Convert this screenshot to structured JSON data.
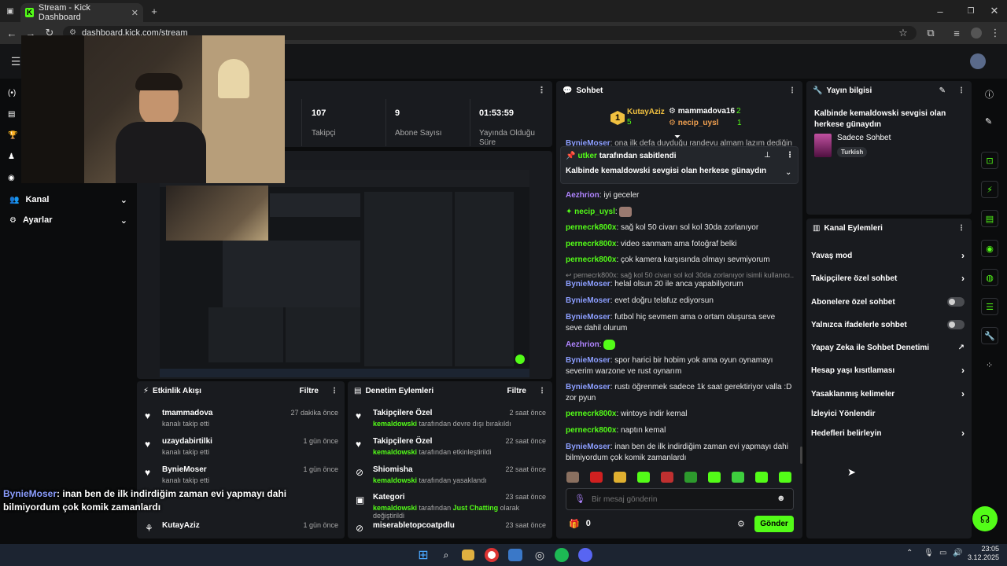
{
  "browser": {
    "tab_title": "Stream - Kick Dashboard",
    "url": "dashboard.kick.com/stream"
  },
  "sidebar": {
    "kanal": "Kanal",
    "ayarlar": "Ayarlar"
  },
  "stats": {
    "followers_value": "107",
    "followers_label": "Takipçi",
    "subs_value": "9",
    "subs_label": "Abone Sayısı",
    "uptime_value": "01:53:59",
    "uptime_label": "Yayında Olduğu Süre"
  },
  "activity": {
    "title": "Etkinlik Akışı",
    "filter": "Filtre",
    "items": [
      {
        "name": "tmammadova",
        "sub": "kanalı takip etti",
        "time": "27 dakika önce"
      },
      {
        "name": "uzaydabirtilki",
        "sub": "kanalı takip etti",
        "time": "1 gün önce"
      },
      {
        "name": "BynieMoser",
        "sub": "kanalı takip etti",
        "time": "1 gün önce"
      },
      {
        "name": "KutayAziz",
        "sub": "",
        "time": "1 gün önce"
      }
    ]
  },
  "moderation": {
    "title": "Denetim Eylemleri",
    "filter": "Filtre",
    "items": [
      {
        "name": "Takipçilere Özel",
        "user": "kemaldowski",
        "rest": "tarafından devre dışı bırakıldı",
        "time": "2 saat önce"
      },
      {
        "name": "Takipçilere Özel",
        "user": "kemaldowski",
        "rest": "tarafından etkinleştirildi",
        "time": "22 saat önce"
      },
      {
        "name": "Shiomisha",
        "user": "kemaldowski",
        "rest": "tarafından yasaklandı",
        "time": "22 saat önce"
      },
      {
        "name": "Kategori",
        "user": "kemaldowski",
        "rest": "tarafından",
        "category": "Just Chatting",
        "rest2": "olarak değiştirildi",
        "time": "23 saat önce"
      },
      {
        "name": "miserabletopcoatpdlu",
        "user": "",
        "rest": "",
        "time": "23 saat önce"
      }
    ]
  },
  "overlay_chat": {
    "user": "BynieMoser",
    "text": ": inan ben de ilk indirdiğim zaman evi yapmayı dahi bilmiyordum çok komik zamanlardı"
  },
  "chat": {
    "title": "Sohbet",
    "top_gifters": [
      {
        "rank": "1",
        "name": "KutayAziz",
        "count": "5"
      },
      {
        "name": "mammadova16",
        "count": "2"
      },
      {
        "name": "necip_uysl",
        "count": "1"
      }
    ],
    "cut_line_user": "BynieMoser",
    "cut_line_text": ": ona ilk defa duyduğu randevu almam lazım dediğin sev",
    "pinned_by": "utker",
    "pinned_label": "tarafından sabitlendi",
    "pinned_text": "Kalbinde kemaldowski sevgisi olan herkese günaydın",
    "messages": [
      {
        "user": "Aezhrion",
        "text": ": iyi geceler",
        "color": "p"
      },
      {
        "user": "necip_uysl",
        "text": ":",
        "color": "g",
        "emote": true
      },
      {
        "user": "pernecrk800x",
        "text": ": sağ kol 50 civarı sol kol 30da zorlanıyor",
        "color": "g"
      },
      {
        "user": "pernecrk800x",
        "text": ": video sanmam ama fotoğraf belki",
        "color": "g"
      },
      {
        "user": "pernecrk800x",
        "text": ": çok kamera karşısında olmayı sevmiyorum",
        "color": "g"
      },
      {
        "reply": "pernecrk800x: sağ kol 50 civarı sol kol 30da zorlanıyor isimli kullanıcı..."
      },
      {
        "user": "BynieMoser",
        "text": ": helal olsun 20 ile anca yapabiliyorum",
        "color": "b"
      },
      {
        "user": "BynieMoser",
        "text": ": evet doğru telafuz ediyorsun",
        "color": "b"
      },
      {
        "user": "BynieMoser",
        "text": ": futbol hiç sevmem ama o ortam oluşursa seve seve dahil olurum",
        "color": "b"
      },
      {
        "user": "Aezhrion",
        "text": ":",
        "color": "p",
        "emote": true
      },
      {
        "user": "BynieMoser",
        "text": ": spor harici bir hobim yok ama oyun oynamayı severim warzone ve rust oynarım",
        "color": "b"
      },
      {
        "user": "BynieMoser",
        "text": ": rustı öğrenmek sadece 1k saat gerektiriyor valla :D zor pyun",
        "color": "b"
      },
      {
        "user": "pernecrk800x",
        "text": ": wintoys indir kemal",
        "color": "g"
      },
      {
        "user": "pernecrk800x",
        "text": ": naptın kemal",
        "color": "g"
      },
      {
        "user": "BynieMoser",
        "text": ": inan ben de ilk indirdiğim zaman evi yapmayı dahi bilmiyordum çok komik zamanlardı",
        "color": "b"
      }
    ],
    "input_placeholder": "Bir mesaj gönderin",
    "points": "0",
    "send": "Gönder"
  },
  "stream_info": {
    "title": "Yayın bilgisi",
    "stream_title": "Kalbinde kemaldowski sevgisi olan herkese günaydın",
    "category": "Sadece Sohbet",
    "language": "Turkish"
  },
  "channel_actions": {
    "title": "Kanal Eylemleri",
    "items": [
      {
        "label": "Yavaş mod",
        "type": "chevron"
      },
      {
        "label": "Takipçilere özel sohbet",
        "type": "chevron"
      },
      {
        "label": "Abonelere özel sohbet",
        "type": "toggle"
      },
      {
        "label": "Yalnızca ifadelerle sohbet",
        "type": "toggle"
      },
      {
        "label": "Yapay Zeka ile Sohbet Denetimi",
        "type": "external"
      },
      {
        "label": "Hesap yaşı kısıtlaması",
        "type": "chevron"
      },
      {
        "label": "Yasaklanmış kelimeler",
        "type": "chevron"
      },
      {
        "label": "İzleyici Yönlendir",
        "type": "none"
      },
      {
        "label": "Hedefleri belirleyin",
        "type": "chevron"
      }
    ]
  },
  "taskbar": {
    "time": "23:05",
    "date": "3.12.2025"
  },
  "colors": {
    "accent": "#53fc18",
    "panel": "#191b1f",
    "background": "#0b0c0d"
  }
}
